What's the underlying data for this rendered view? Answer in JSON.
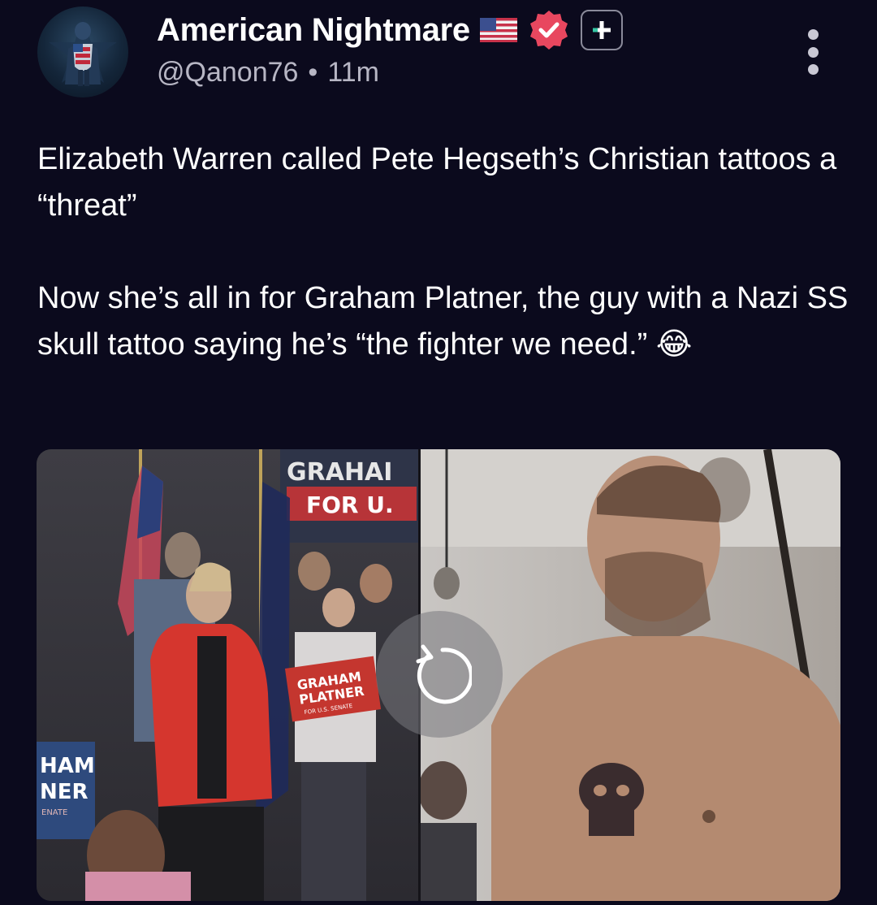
{
  "author": {
    "display_name": "American Nightmare",
    "handle": "@Qanon76",
    "time_ago": "11m",
    "separator": "•",
    "avatar_icon": "captain-america-avatar-icon",
    "flag_icon": "us-flag-icon",
    "verified_icon": "verified-badge-icon",
    "follow_icon": "plus-icon"
  },
  "post": {
    "text": "Elizabeth Warren called Pete Hegseth’s Christian tattoos a “threat”\n\nNow she’s all in for Graham Platner, the guy with a Nazi SS skull tattoo saying he’s “the fighter we need.” 😂"
  },
  "media": {
    "banner_top": "GRAHAI",
    "banner_bottom": "FOR U.",
    "sign_line1": "GRAHAM",
    "sign_line2": "PLATNER",
    "sign_line3": "FOR U.S. SENATE",
    "left_sign_line1": "HAM",
    "left_sign_line2": "NER",
    "left_sign_line3": "ENATE",
    "replay_icon": "replay-icon"
  },
  "colors": {
    "background": "#0b0a1d",
    "verified_badge": "#e8475f",
    "muted_text": "#b7b6c4"
  }
}
